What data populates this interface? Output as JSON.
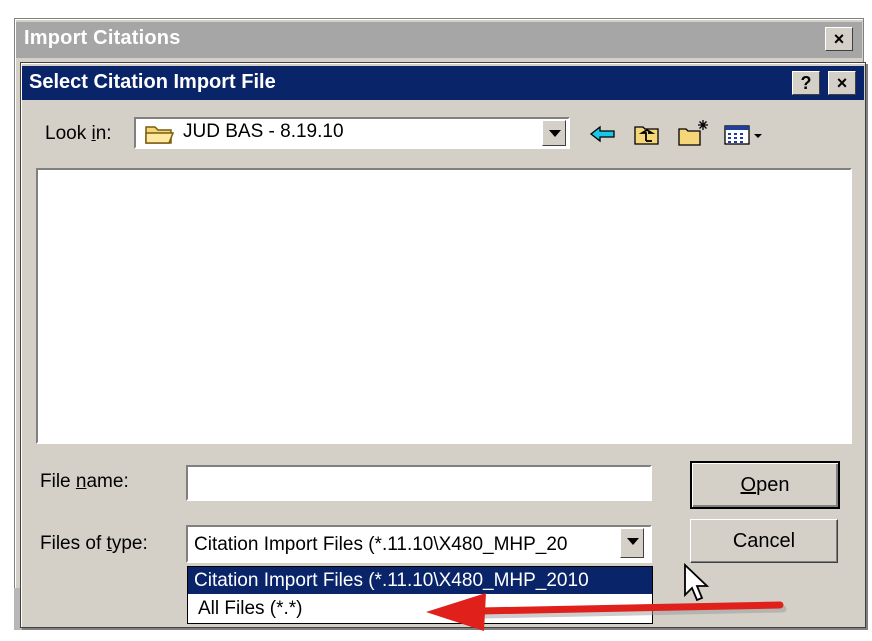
{
  "outer_window": {
    "title": "Import Citations",
    "close_label": "×"
  },
  "dialog": {
    "title": "Select Citation Import File",
    "help_label": "?",
    "close_label": "×"
  },
  "look_in": {
    "label_pre": "Look ",
    "label_accel": "i",
    "label_post": "n:",
    "value": "JUD BAS - 8.19.10"
  },
  "toolbar": {
    "icons": [
      "back-icon",
      "up-folder-icon",
      "new-folder-icon",
      "view-menu-icon"
    ]
  },
  "file_name": {
    "label_pre": "File ",
    "label_accel": "n",
    "label_post": "ame:",
    "value": ""
  },
  "files_of_type": {
    "label_pre": "Files of ",
    "label_accel": "t",
    "label_post": "ype:",
    "value": "Citation Import Files (*.11.10\\X480_MHP_20",
    "options": [
      "Citation Import Files (*.11.10\\X480_MHP_2010",
      "All Files (*.*)"
    ],
    "selected_index": 0
  },
  "buttons": {
    "open_accel": "O",
    "open_rest": "pen",
    "cancel": "Cancel"
  },
  "colors": {
    "titlebar_active": "#0a246a",
    "titlebar_inactive": "#a6a6a6",
    "face": "#d4d0c8",
    "annotation_arrow": "#e0201a"
  }
}
